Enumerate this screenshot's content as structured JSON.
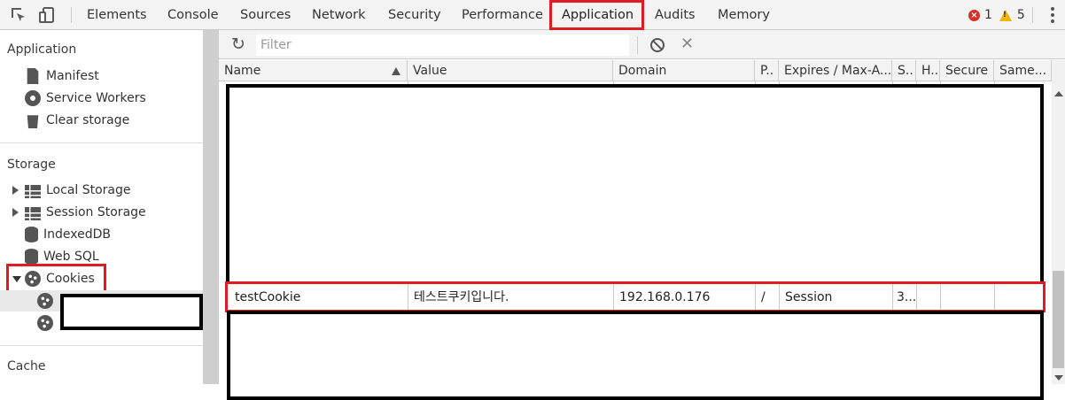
{
  "toolbar": {
    "tabs": [
      "Elements",
      "Console",
      "Sources",
      "Network",
      "Security",
      "Performance",
      "Application",
      "Audits",
      "Memory"
    ],
    "active_tab": "Application",
    "error_count": "1",
    "warning_count": "5"
  },
  "sidebar": {
    "application_header": "Application",
    "application_items": [
      "Manifest",
      "Service Workers",
      "Clear storage"
    ],
    "storage_header": "Storage",
    "storage_items": [
      "Local Storage",
      "Session Storage",
      "IndexedDB",
      "Web SQL",
      "Cookies"
    ],
    "cache_header": "Cache"
  },
  "main": {
    "filter_placeholder": "Filter",
    "columns": [
      "Name",
      "Value",
      "Domain",
      "P..",
      "Expires / Max-A...",
      "S..",
      "H..",
      "Secure",
      "Same..."
    ],
    "cookie_row": {
      "name": "testCookie",
      "value": "테스트쿠키입니다.",
      "domain": "192.168.0.176",
      "path": "/",
      "expires": "Session",
      "size": "3..."
    }
  },
  "colors": {
    "highlight_red": "#e01b24",
    "panel_bg": "#f3f3f3"
  }
}
